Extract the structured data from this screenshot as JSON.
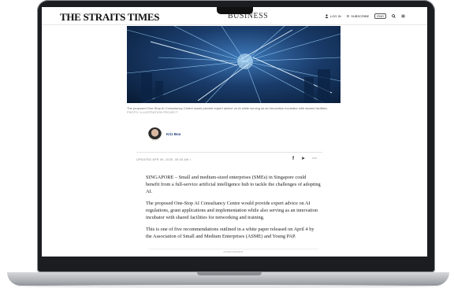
{
  "header": {
    "masthead": "THE STRAITS TIMES",
    "section": "BUSINESS",
    "login_label": "LOG IN",
    "subscribe_label": "SUBSCRIBE",
    "edition_label": "ENG"
  },
  "hero": {
    "caption": "The proposed One-Stop AI Consultancy Centre would provide expert advice on AI while serving as an innovation incubator with shared facilities.",
    "credit": "PHOTO: ILLUSTRATION PROJECT"
  },
  "author": {
    "name": "Kriz Boo"
  },
  "meta": {
    "updated": "UPDATED APR 06, 2025, 05:00 AM •"
  },
  "share_icons": [
    "facebook-icon",
    "telegram-icon",
    "more-icon"
  ],
  "article": {
    "paragraphs": [
      "SINGAPORE – Small and medium-sized enterprises (SMEs) in Singapore could benefit from a full-service artificial intelligence hub to tackle the challenges of adopting AI.",
      "The proposed One-Stop AI Consultancy Centre would provide expert advice on AI regulations, grant applications and implementation while also serving as an innovation incubator with shared facilities for networking and training.",
      "This is one of five recommendations outlined in a white paper released on April 4 by the Association of Small and Medium Enterprises (ASME) and Young PAP."
    ]
  },
  "ad_label": "ADVERTISEMENT",
  "colors": {
    "author": "#1b3b7a",
    "hero_dark": "#081a33",
    "hero_light": "#3d78b8",
    "laptop_frame": "#1c1d20"
  }
}
